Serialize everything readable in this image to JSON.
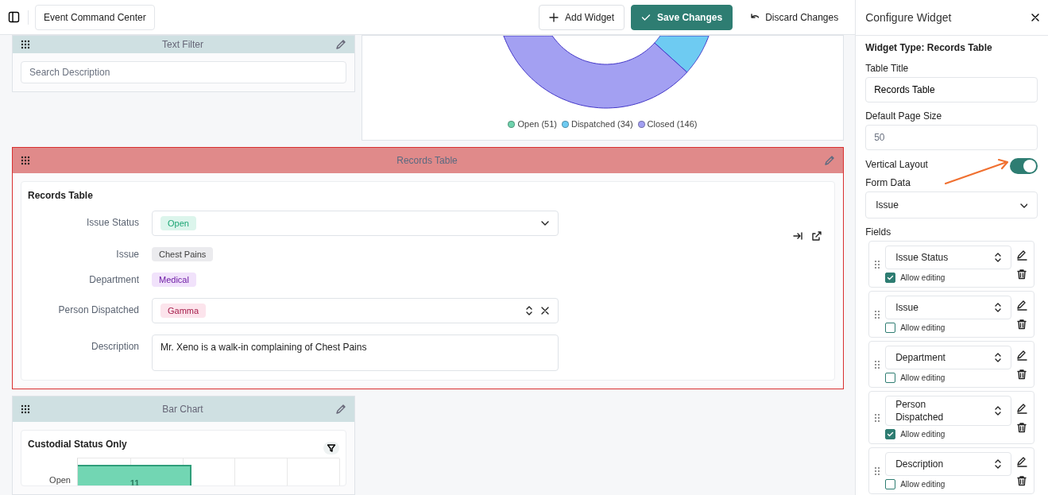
{
  "topbar": {
    "dashboard_name": "Event Command Center",
    "buttons": [
      {
        "kind": "add",
        "label": "Add Widget"
      },
      {
        "kind": "save",
        "label": "Save Changes"
      },
      {
        "kind": "discard",
        "label": "Discard Changes"
      }
    ]
  },
  "widgets": [
    {
      "kind": "text_filter",
      "title": "Text Filter",
      "selected": false,
      "placeholder": "Search Description"
    },
    {
      "kind": "donut",
      "selected": false,
      "legend": [
        {
          "label": "Open",
          "count": "(51)",
          "color": "#6fd3ad"
        },
        {
          "label": "Dispatched",
          "count": "(34)",
          "color": "#6ecbf2"
        },
        {
          "label": "Closed",
          "count": "(146)",
          "color": "#a3a0f2"
        }
      ]
    },
    {
      "kind": "records",
      "title": "Records Table",
      "selected": true,
      "card_title": "Records Table",
      "fields": [
        {
          "kind": "select",
          "label": "Issue Status",
          "tag": "Open",
          "color": "#dcf5ec"
        },
        {
          "kind": "tag",
          "label": "Issue",
          "tag": "Chest Pains",
          "color": "#ebebee"
        },
        {
          "kind": "tag",
          "label": "Department",
          "tag": "Medical",
          "color": "#f1e2fb"
        },
        {
          "kind": "multi",
          "label": "Person Dispatched",
          "tag": "Gamma",
          "color": "#fce4ec"
        },
        {
          "kind": "textarea",
          "label": "Description",
          "value": "Mr. Xeno is a walk-in complaining of Chest Pains"
        },
        {
          "kind": "cut_off"
        }
      ]
    },
    {
      "kind": "bar",
      "title": "Bar Chart",
      "selected": false,
      "card_title": "Custodial Status Only",
      "axis_label": "Open",
      "bar_label": "11"
    }
  ],
  "panel": {
    "title": "Configure Widget",
    "widget_type": "Widget Type: Records Table",
    "table_title": {
      "label": "Table Title",
      "value": "Records Table"
    },
    "page_size": {
      "label": "Default Page Size",
      "placeholder": "50"
    },
    "vertical_layout": {
      "label": "Vertical Layout",
      "on": true
    },
    "form_data": {
      "label": "Form Data",
      "value": "Issue"
    },
    "fields_label": "Fields",
    "fields": [
      {
        "name": "Issue Status",
        "allow_label": "Allow editing",
        "checked": true
      },
      {
        "name": "Issue",
        "allow_label": "Allow editing",
        "checked": false
      },
      {
        "name": "Department",
        "allow_label": "Allow editing",
        "checked": false
      },
      {
        "name": "Person Dispatched",
        "allow_label": "Allow editing",
        "checked": true
      },
      {
        "name": "Description",
        "allow_label": "Allow editing",
        "checked": false
      }
    ]
  }
}
